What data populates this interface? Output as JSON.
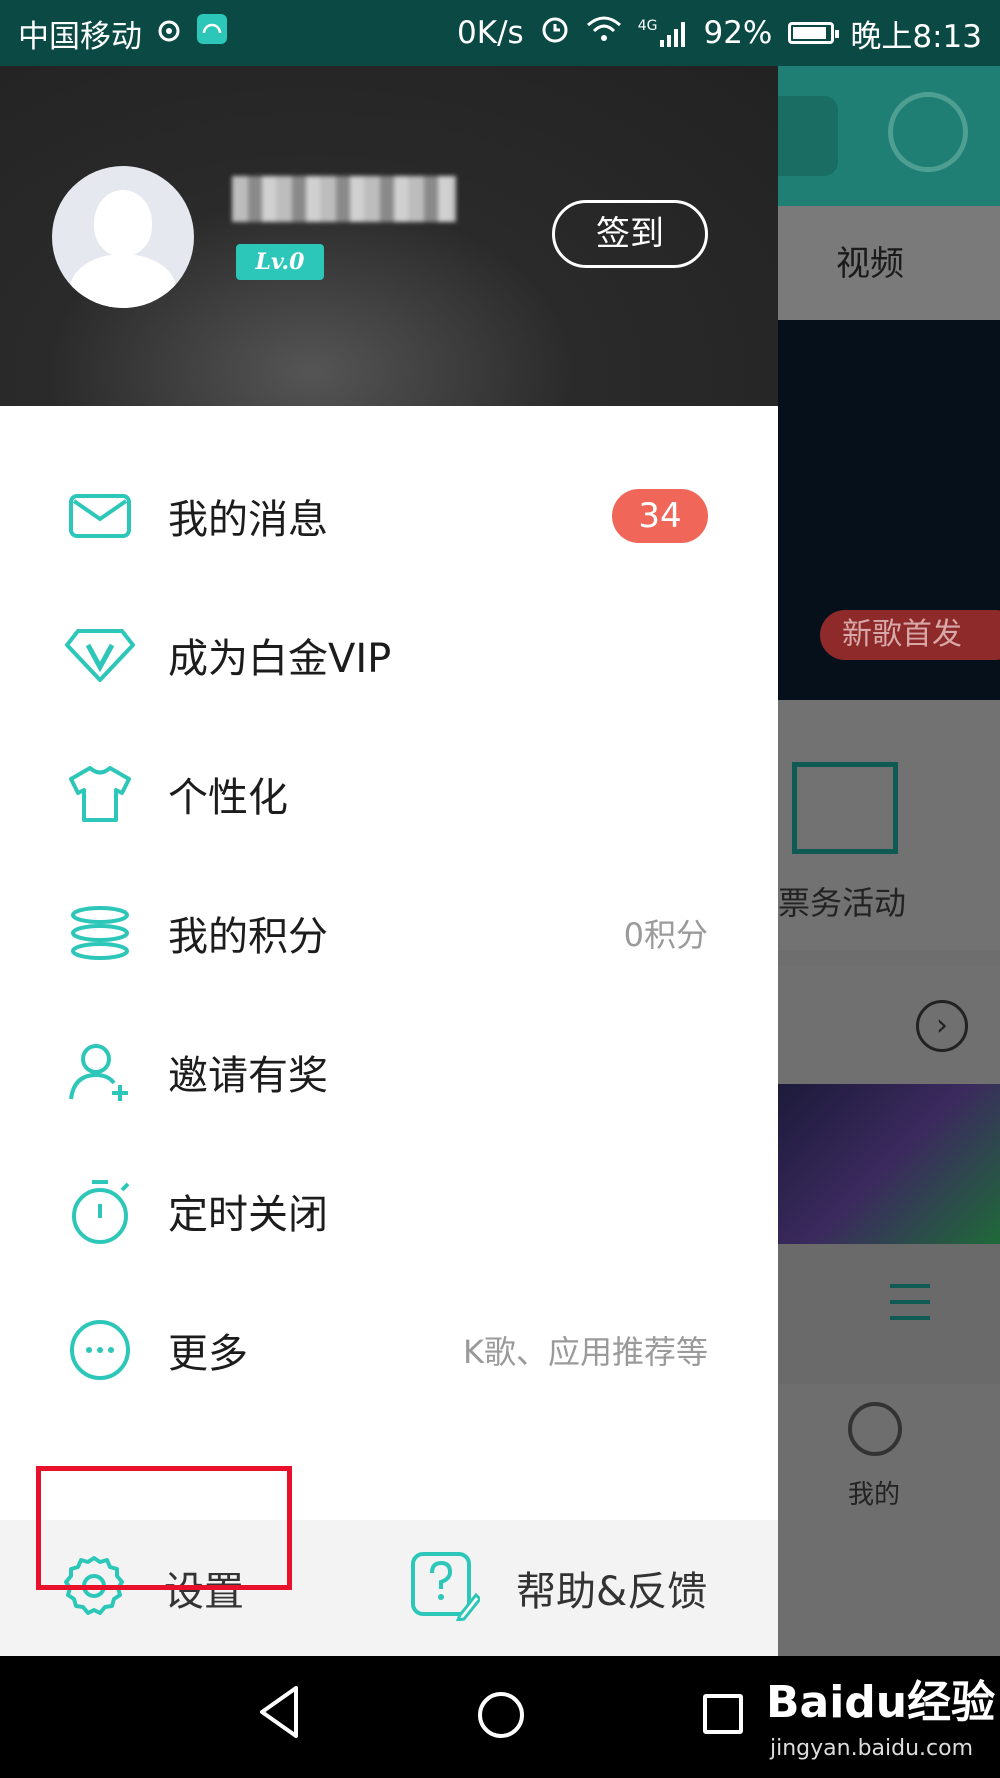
{
  "statusbar": {
    "carrier": "中国移动",
    "net_speed": "0K/s",
    "network": "4G",
    "battery_text": "92%",
    "battery_level": 0.92,
    "time": "晚上8:13"
  },
  "profile": {
    "level": "Lv.0",
    "checkin_label": "签到"
  },
  "menu": [
    {
      "label": "我的消息",
      "extra": "",
      "badge": "34",
      "icon": "mail-icon"
    },
    {
      "label": "成为白金VIP",
      "extra": "",
      "badge": "",
      "icon": "vip-diamond-icon"
    },
    {
      "label": "个性化",
      "extra": "",
      "badge": "",
      "icon": "tshirt-icon"
    },
    {
      "label": "我的积分",
      "extra": "0积分",
      "badge": "",
      "icon": "coins-icon"
    },
    {
      "label": "邀请有奖",
      "extra": "",
      "badge": "",
      "icon": "invite-user-icon"
    },
    {
      "label": "定时关闭",
      "extra": "",
      "badge": "",
      "icon": "timer-icon"
    },
    {
      "label": "更多",
      "extra": "K歌、应用推荐等",
      "badge": "",
      "icon": "more-icon"
    }
  ],
  "footer": {
    "settings_label": "设置",
    "help_label": "帮助&反馈"
  },
  "background_app": {
    "tab_video": "视频",
    "new_song_tag": "新歌首发",
    "ticket_label": "票务活动",
    "me_label": "我的"
  },
  "watermark": {
    "brand": "Baidu经验",
    "url": "jingyan.baidu.com"
  },
  "colors": {
    "accent": "#2cc7b8",
    "badge": "#f0675a",
    "highlight": "#e8102a",
    "statusbar": "#0b4a44"
  }
}
